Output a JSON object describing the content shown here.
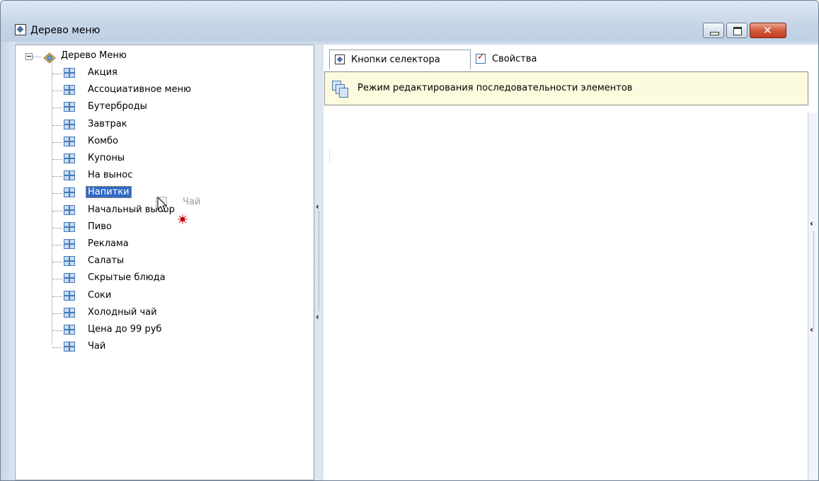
{
  "window": {
    "title": "Дерево меню",
    "close_glyph": "✕"
  },
  "tree": {
    "root_label": "Дерево Меню",
    "items": [
      "Акция",
      "Ассоциативное меню",
      "Бутерброды",
      "Завтрак",
      "Комбо",
      "Купоны",
      "На вынос",
      "Напитки",
      "Начальный выбор",
      "Пиво",
      "Реклама",
      "Салаты",
      "Скрытые блюда",
      "Соки",
      "Холодный чай",
      "Цена до 99 руб",
      "Чай"
    ],
    "selected": "Напитки",
    "drag_label": "Чай"
  },
  "tabs": [
    {
      "label": "Кнопки селектора",
      "icon": "selector-icon",
      "active": true
    },
    {
      "label": "Свойства",
      "icon": "checkbox-icon",
      "active": false
    }
  ],
  "infobar": {
    "text": "Режим редактирования последовательности элементов",
    "icon": "copy-pages-icon"
  },
  "colors": {
    "selection": "#3169c6",
    "infobar_bg": "#fdfbdd",
    "titlebar": "#c7d6e7"
  }
}
